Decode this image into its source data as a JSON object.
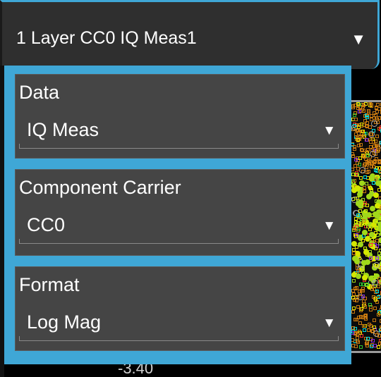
{
  "trace_selector": {
    "label": "1 Layer CC0 IQ Meas1"
  },
  "dropdown": {
    "groups": [
      {
        "label": "Data",
        "value": "IQ Meas"
      },
      {
        "label": "Component Carrier",
        "value": "CC0"
      },
      {
        "label": "Format",
        "value": "Log Mag"
      }
    ]
  },
  "plot": {
    "axis_label": "-3.40"
  },
  "colors": {
    "accent": "#3fa7d6",
    "panel_bg": "#454545",
    "header_bg": "#2f2f2f",
    "constellation": [
      "#a0d81a",
      "#d4e800",
      "#c97a10",
      "#e8e000",
      "#00e0e0",
      "#ff3030",
      "#8a2be2",
      "#30c030"
    ]
  }
}
